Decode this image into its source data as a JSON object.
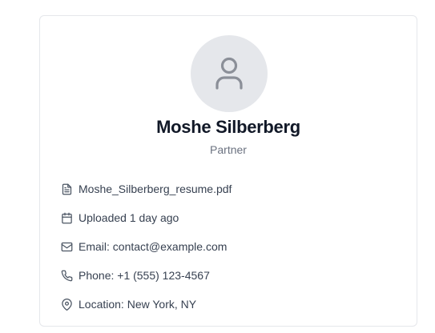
{
  "profile": {
    "name": "Moshe Silberberg",
    "role": "Partner",
    "avatar_icon": "user-icon"
  },
  "details": [
    {
      "icon": "file-text-icon",
      "text": "Moshe_Silberberg_resume.pdf"
    },
    {
      "icon": "calendar-icon",
      "text": "Uploaded 1 day ago"
    },
    {
      "icon": "mail-icon",
      "text": "Email: contact@example.com"
    },
    {
      "icon": "phone-icon",
      "text": "Phone: +1 (555) 123-4567"
    },
    {
      "icon": "map-pin-icon",
      "text": "Location: New York, NY"
    }
  ],
  "colors": {
    "avatar_bg": "#e5e7eb",
    "icon_stroke": "#6b7280",
    "name_text": "#111827",
    "muted_text": "#6b7280"
  }
}
